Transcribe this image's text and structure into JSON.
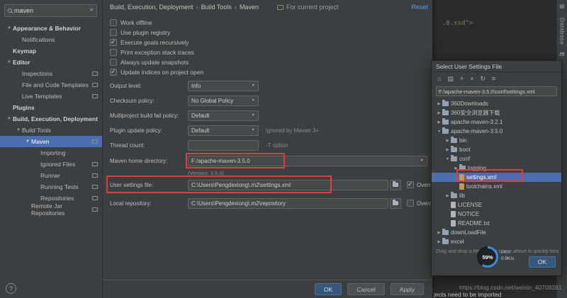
{
  "icons": {
    "chevron_down": "▼",
    "chevron_right": "▶",
    "grid": "▤"
  },
  "window": {
    "search_value": "maven",
    "search_clear_glyph": "×",
    "help_label": "?"
  },
  "sidebar": {
    "items": [
      {
        "label": "Appearance & Behavior",
        "indent": 0,
        "arrow": "down",
        "bold": true
      },
      {
        "label": "Notifications",
        "indent": 1
      },
      {
        "label": "Keymap",
        "indent": 0,
        "bold": true
      },
      {
        "label": "Editor",
        "indent": 0,
        "arrow": "down",
        "bold": true
      },
      {
        "label": "Inspections",
        "indent": 1,
        "badge": true
      },
      {
        "label": "File and Code Templates",
        "indent": 1,
        "badge": true
      },
      {
        "label": "Live Templates",
        "indent": 1,
        "badge": true
      },
      {
        "label": "Plugins",
        "indent": 0,
        "bold": true
      },
      {
        "label": "Build, Execution, Deployment",
        "indent": 0,
        "arrow": "down",
        "bold": true
      },
      {
        "label": "Build Tools",
        "indent": 1,
        "arrow": "down"
      },
      {
        "label": "Maven",
        "indent": 2,
        "arrow": "down",
        "selected": true,
        "badge": true
      },
      {
        "label": "Importing",
        "indent": 3
      },
      {
        "label": "Ignored Files",
        "indent": 3,
        "badge": true
      },
      {
        "label": "Runner",
        "indent": 3,
        "badge": true
      },
      {
        "label": "Running Tests",
        "indent": 3,
        "badge": true
      },
      {
        "label": "Repositories",
        "indent": 3,
        "badge": true
      },
      {
        "label": "Remote Jar Repositories",
        "indent": 2,
        "badge": true
      }
    ]
  },
  "header": {
    "breadcrumb": [
      "Build, Execution, Deployment",
      "Build Tools",
      "Maven"
    ],
    "separator": "›",
    "for_current_project": "For current project",
    "reset": "Reset"
  },
  "options": {
    "checkboxes": [
      {
        "label": "Work offline",
        "checked": false
      },
      {
        "label": "Use plugin registry",
        "checked": false
      },
      {
        "label": "Execute goals recursively",
        "checked": true
      },
      {
        "label": "Print exception stack traces",
        "checked": false
      },
      {
        "label": "Always update snapshots",
        "checked": false
      },
      {
        "label": "Update indices on project open",
        "checked": true
      }
    ]
  },
  "fields": {
    "output_level": {
      "label": "Output level:",
      "value": "Info"
    },
    "checksum_policy": {
      "label": "Checksum policy:",
      "value": "No Global Policy"
    },
    "multiproject_policy": {
      "label": "Multiproject build fail policy:",
      "value": "Default"
    },
    "plugin_update_policy": {
      "label": "Plugin update policy:",
      "value": "Default",
      "note": "ignored by Maven 3+"
    },
    "thread_count": {
      "label": "Thread count:",
      "value": "",
      "note": "-T option"
    },
    "maven_home": {
      "label": "Maven home directory:",
      "value": "F:/apache-maven-3.5.0",
      "version_note": "(Version: 3.5.0)"
    },
    "user_settings": {
      "label": "User settings file:",
      "value": "C:\\Users\\Pengdexiong\\.m2\\settings.xml",
      "override_label": "Overr",
      "override_checked": true
    },
    "local_repository": {
      "label": "Local repository:",
      "value": "C:\\Users\\Pengdexiong\\.m2\\repository",
      "override_label": "Overr",
      "override_checked": false
    }
  },
  "footer_buttons": {
    "ok": "OK",
    "cancel": "Cancel",
    "apply": "Apply"
  },
  "dialog": {
    "title": "Select User Settings File",
    "toolbar_icons": [
      {
        "name": "home-icon",
        "glyph": "⌂"
      },
      {
        "name": "desktop-icon",
        "glyph": "▤"
      },
      {
        "name": "new-folder-icon",
        "glyph": "+"
      },
      {
        "name": "delete-icon",
        "glyph": "×"
      },
      {
        "name": "refresh-icon",
        "glyph": "↻"
      },
      {
        "name": "show-hidden-icon",
        "glyph": "≡"
      }
    ],
    "path": "F:\\apache-maven-3.5.0\\conf\\settings.xml",
    "tree": [
      {
        "label": "360Downloads",
        "indent": 0,
        "arrow": "right",
        "icon": "folder"
      },
      {
        "label": "360安全浏览器下载",
        "indent": 0,
        "arrow": "right",
        "icon": "folder"
      },
      {
        "label": "apache-maven-3.2.1",
        "indent": 0,
        "arrow": "right",
        "icon": "folder"
      },
      {
        "label": "apache-maven-3.5.0",
        "indent": 0,
        "arrow": "down",
        "icon": "folder"
      },
      {
        "label": "bin",
        "indent": 1,
        "arrow": "right",
        "icon": "folder"
      },
      {
        "label": "boot",
        "indent": 1,
        "arrow": "right",
        "icon": "folder"
      },
      {
        "label": "conf",
        "indent": 1,
        "arrow": "down",
        "icon": "folder"
      },
      {
        "label": "logging",
        "indent": 2,
        "arrow": "right",
        "icon": "folder"
      },
      {
        "label": "settings.xml",
        "indent": 2,
        "icon": "xml",
        "selected": true
      },
      {
        "label": "toolchains.xml",
        "indent": 2,
        "icon": "xml"
      },
      {
        "label": "lib",
        "indent": 1,
        "arrow": "right",
        "icon": "folder"
      },
      {
        "label": "LICENSE",
        "indent": 1,
        "icon": "file"
      },
      {
        "label": "NOTICE",
        "indent": 1,
        "icon": "file"
      },
      {
        "label": "README.txt",
        "indent": 1,
        "icon": "file"
      },
      {
        "label": "downLoadFile",
        "indent": 0,
        "arrow": "right",
        "icon": "folder"
      },
      {
        "label": "excel",
        "indent": 0,
        "arrow": "right",
        "icon": "folder"
      }
    ],
    "hint": "Drag and drop a file into the space above to quickly locate",
    "ok": "OK"
  },
  "overlay": {
    "percent": "59%",
    "up_speed": "0K/s",
    "down_speed": "0.9K/s"
  },
  "editor": {
    "code_line": ".0.xsd\">",
    "right_strip": {
      "top_label": "Database",
      "maven_label": "m"
    }
  },
  "watermark": {
    "url": "https://blog.csdn.net/weixin_40708281",
    "status_text": "jects need to be imported"
  }
}
